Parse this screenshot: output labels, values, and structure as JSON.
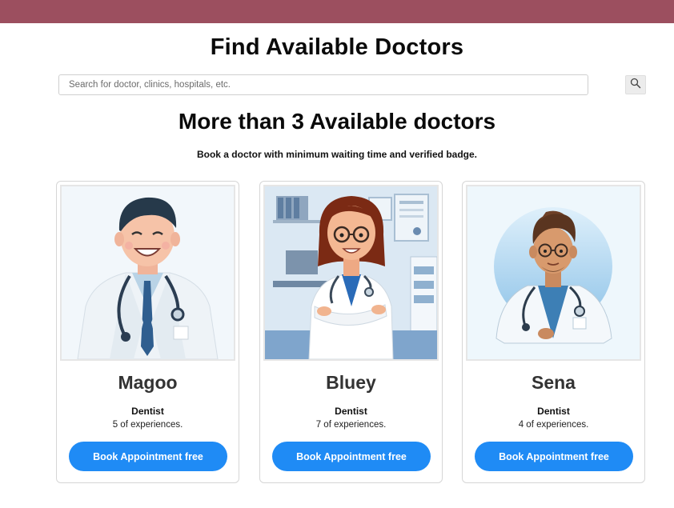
{
  "header": {
    "title": "Find Available Doctors"
  },
  "search": {
    "placeholder": "Search for doctor, clinics, hospitals, etc.",
    "button_icon": "search-icon"
  },
  "section": {
    "title": "More than 3 Available doctors",
    "subtitle": "Book a doctor with minimum waiting time and verified badge."
  },
  "doctors": [
    {
      "name": "Magoo",
      "specialty": "Dentist",
      "experience": "5 of experiences.",
      "button_label": "Book Appointment free"
    },
    {
      "name": "Bluey",
      "specialty": "Dentist",
      "experience": "7 of experiences.",
      "button_label": "Book Appointment free"
    },
    {
      "name": "Sena",
      "specialty": "Dentist",
      "experience": "4 of experiences.",
      "button_label": "Book Appointment free"
    }
  ],
  "colors": {
    "topbar": "#9c4f5f",
    "button": "#1f8bf5"
  }
}
